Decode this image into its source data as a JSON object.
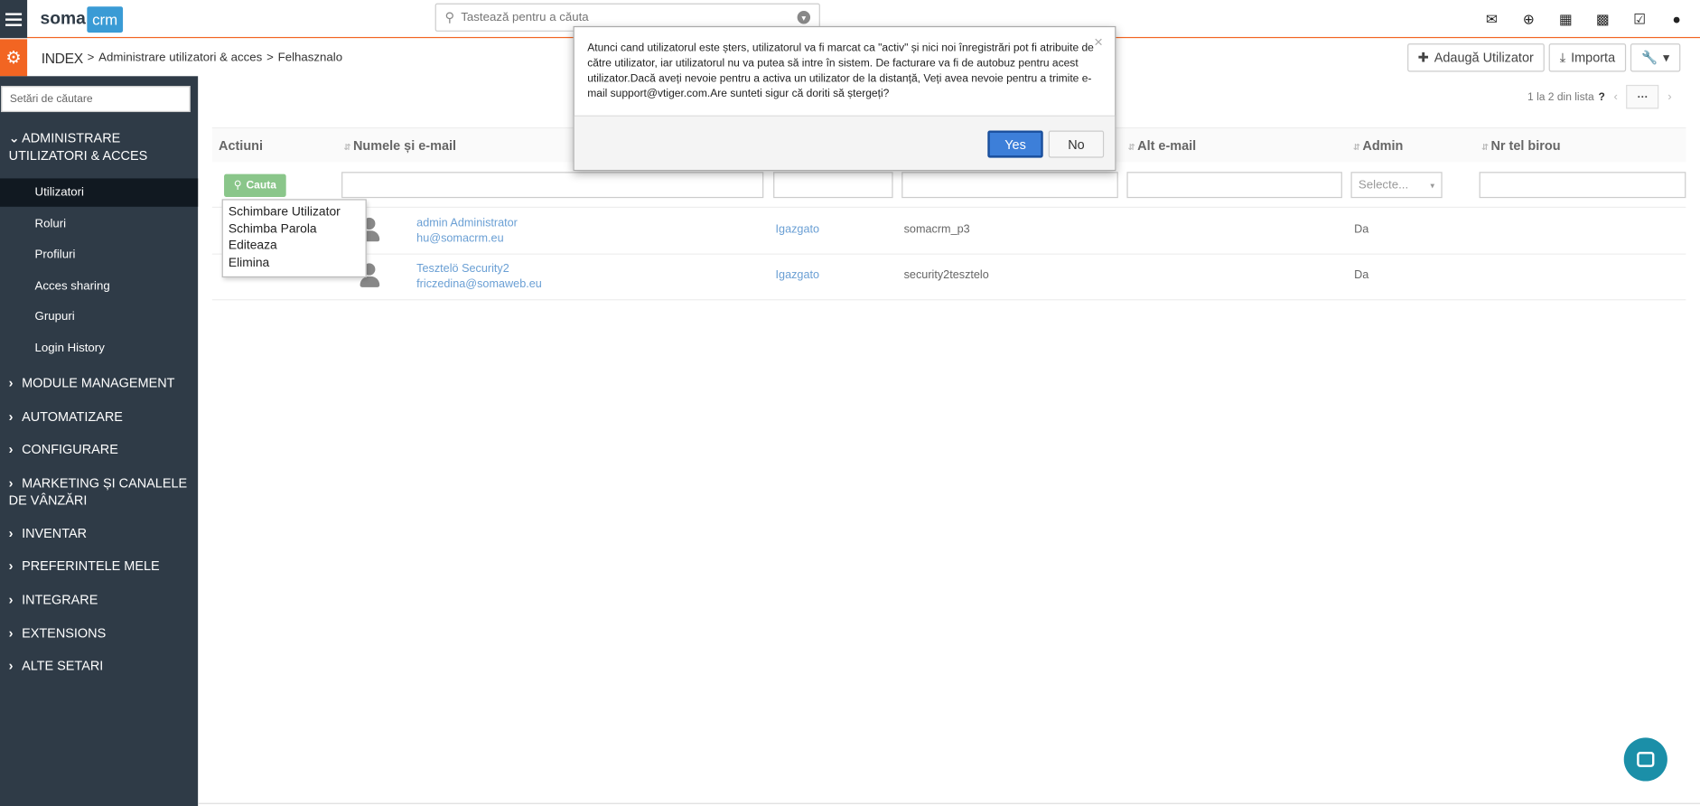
{
  "topbar": {
    "logo_soma": "soma",
    "logo_crm": "crm",
    "search_placeholder": "Tastează pentru a căuta",
    "icons": [
      "envelope-icon",
      "plus-circle-icon",
      "calendar-icon",
      "bar-chart-icon",
      "checkbox-icon",
      "user-icon"
    ]
  },
  "secbar": {
    "breadcrumb": {
      "index": "INDEX",
      "sep": ">",
      "level1": "Administrare utilizatori & acces",
      "level2": "Felhasznalo"
    },
    "add_user_label": "Adaugă Utilizator",
    "import_label": "Importa"
  },
  "sidebar": {
    "search_placeholder": "Setări de căutare",
    "sections": [
      {
        "label": "ADMINISTRARE UTILIZATORI & ACCES",
        "expanded": true
      },
      {
        "label": "MODULE MANAGEMENT"
      },
      {
        "label": "AUTOMATIZARE"
      },
      {
        "label": "CONFIGURARE"
      },
      {
        "label": "MARKETING ȘI CANALELE DE VÂNZĂRI"
      },
      {
        "label": "INVENTAR"
      },
      {
        "label": "PREFERINTELE MELE"
      },
      {
        "label": "INTEGRARE"
      },
      {
        "label": "EXTENSIONS"
      },
      {
        "label": "ALTE SETARI"
      }
    ],
    "sub_items": [
      "Utilizatori",
      "Roluri",
      "Profiluri",
      "Acces sharing",
      "Grupuri",
      "Login History"
    ]
  },
  "pager": {
    "text": "1 la 2  din lista",
    "help": "?",
    "more": "···"
  },
  "table": {
    "headers": [
      "Actiuni",
      "Numele și e-mail",
      "Alt e-mail",
      "Admin",
      "Nr tel birou"
    ],
    "filter_button": "Cauta",
    "admin_select_placeholder": "Selecte...",
    "rows": [
      {
        "name": "admin Administrator",
        "email": "hu@somacrm.eu",
        "role": "Igazgato",
        "username": "somacrm_p3",
        "admin": "Da"
      },
      {
        "name": "Tesztelö Security2",
        "email": "friczedina@somaweb.eu",
        "role": "Igazgato",
        "username": "security2tesztelo",
        "admin": "Da"
      }
    ]
  },
  "context_menu": [
    "Schimbare Utilizator",
    "Schimba Parola",
    "Editeaza",
    "Elimina"
  ],
  "modal": {
    "message": "Atunci cand utilizatorul este șters, utilizatorul va fi marcat ca \"activ\" și nici noi înregistrări pot fi atribuite de către utilizator, iar utilizatorul nu va putea să intre în sistem. De facturare va fi de autobuz pentru acest utilizator.Dacă aveți nevoie pentru a activa un utilizator de la distanță, Veți avea nevoie pentru a trimite e-mail support@vtiger.com.Are sunteti sigur că doriti să ștergeți?",
    "yes_label": "Yes",
    "no_label": "No",
    "close": "×"
  }
}
